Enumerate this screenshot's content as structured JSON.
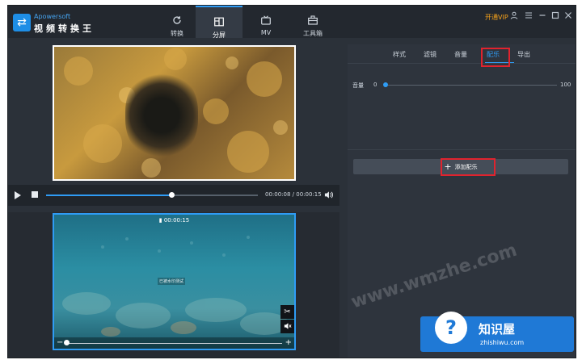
{
  "app": {
    "brand": "Apowersoft",
    "name": "视频转换王"
  },
  "nav": {
    "tabs": [
      {
        "label": "转换",
        "icon": "refresh-icon"
      },
      {
        "label": "分屏",
        "icon": "split-screen-icon"
      },
      {
        "label": "MV",
        "icon": "tv-icon"
      },
      {
        "label": "工具箱",
        "icon": "toolbox-icon"
      }
    ],
    "active_tab": "分屏"
  },
  "window_controls": {
    "vip_label": "开通VIP",
    "icons": [
      "user-icon",
      "list-icon",
      "minimize-icon",
      "maximize-icon",
      "close-icon"
    ]
  },
  "player": {
    "time": "00:00:08 / 00:00:15",
    "progress_fraction": 0.59
  },
  "clip": {
    "duration": "00:00:15",
    "watermark_text": "已被水印测试"
  },
  "panel": {
    "tabs": [
      "样式",
      "滤镜",
      "音量",
      "配乐",
      "导出"
    ],
    "active_tab": "配乐",
    "volume": {
      "label": "音量",
      "min": "0",
      "max": "100",
      "value": 0
    },
    "add_music_button": "添加配乐"
  },
  "watermark": {
    "title": "知识屋",
    "url": "zhishiwu.com",
    "overlay": "www.wmzhe.com"
  },
  "colors": {
    "accent": "#2f9cf5",
    "highlight": "#e0232e",
    "vip": "#f7a31a"
  }
}
